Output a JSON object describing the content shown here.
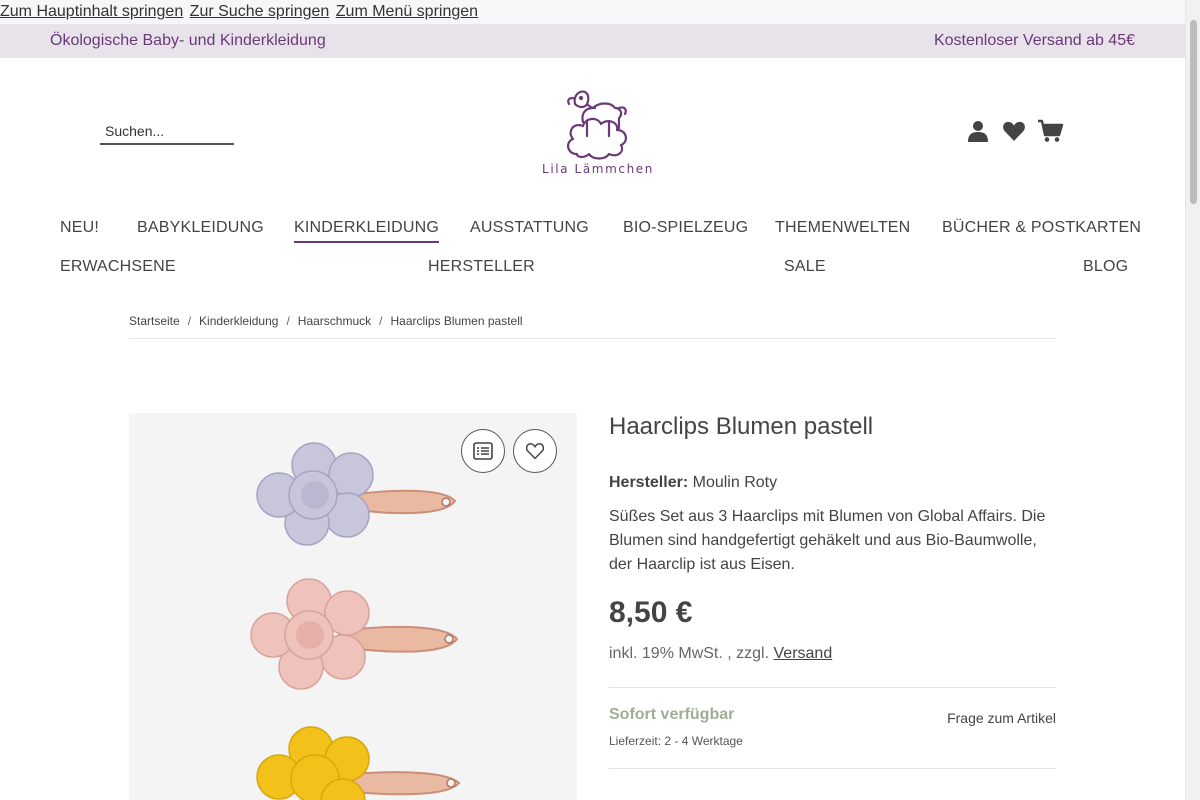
{
  "skip_links": [
    "Zum Hauptinhalt springen",
    "Zur Suche springen",
    "Zum Menü springen"
  ],
  "topbar": {
    "left_text": "Ökologische Baby- und Kinderkleidung",
    "right_text": "Kostenloser Versand ab 45€"
  },
  "search": {
    "placeholder": "Suchen..."
  },
  "logo": {
    "brand": "Lila Lämmchen"
  },
  "header_icons": [
    "user-icon",
    "heart-icon",
    "cart-icon"
  ],
  "nav": {
    "row1": [
      "NEU!",
      "BABYKLEIDUNG",
      "KINDERKLEIDUNG",
      "AUSSTATTUNG",
      "BIO-SPIELZEUG",
      "THEMENWELTEN",
      "BÜCHER & POSTKARTEN"
    ],
    "row2": [
      "ERWACHSENE",
      "HERSTELLER",
      "SALE",
      "BLOG"
    ],
    "active": "KINDERKLEIDUNG"
  },
  "breadcrumb": [
    "Startseite",
    "Kinderkleidung",
    "Haarschmuck",
    "Haarclips Blumen pastell"
  ],
  "product": {
    "title": "Haarclips Blumen pastell",
    "maker_label": "Hersteller:",
    "maker": "Moulin Roty",
    "description": "Süßes Set aus 3 Haarclips mit Blumen von Global Affairs. Die Blumen sind handgefertigt gehäkelt und aus Bio-Baumwolle, der Haarclip ist aus Eisen.",
    "price": "8,50 €",
    "tax_prefix": "inkl. 19% MwSt. , zzgl. ",
    "shipping_link": "Versand",
    "availability": "Sofort verfügbar",
    "delivery": "Lieferzeit: 2 - 4 Werktage",
    "ask_link": "Frage zum Artikel"
  },
  "colors": {
    "brand": "#6a3a78",
    "topbar_bg": "#e8e3ea",
    "availability": "#9fae96"
  }
}
